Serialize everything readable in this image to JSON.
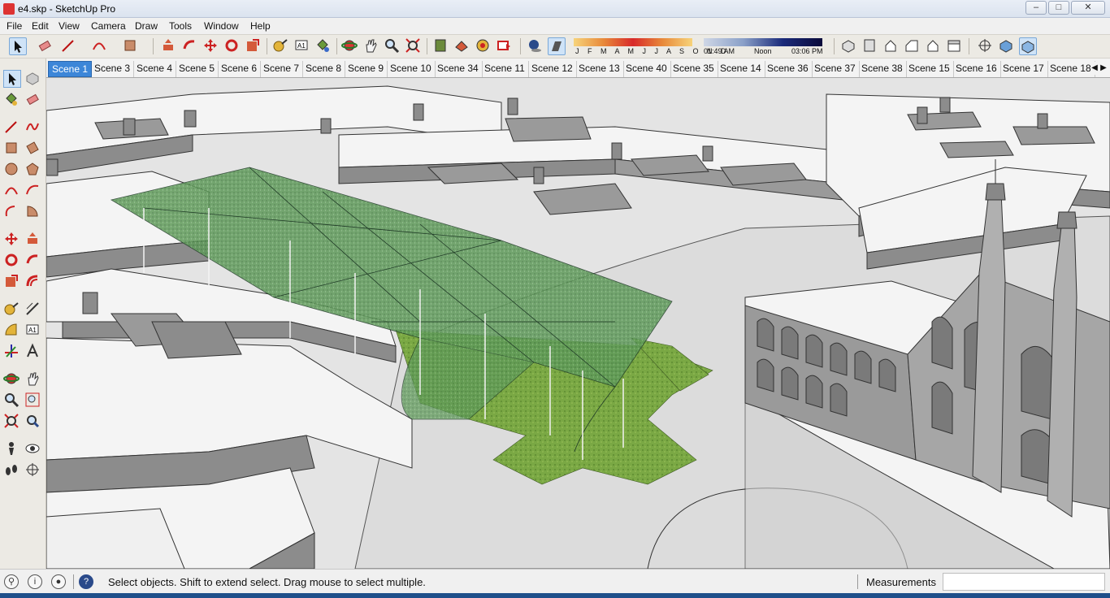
{
  "window": {
    "title": "e4.skp - SketchUp Pro",
    "controls": [
      "minimize",
      "maximize",
      "close"
    ]
  },
  "menu": [
    "File",
    "Edit",
    "View",
    "Camera",
    "Draw",
    "Tools",
    "Window",
    "Help"
  ],
  "shadow_settings": {
    "months": "J F M A M J J A S O N D",
    "time_start": "01:49 AM",
    "time_noon": "Noon",
    "time_end": "03:06 PM"
  },
  "scenes": {
    "active": "Scene 1",
    "tabs": [
      "Scene 1",
      "Scene 3",
      "Scene 4",
      "Scene 5",
      "Scene 6",
      "Scene 7",
      "Scene 8",
      "Scene 9",
      "Scene 10",
      "Scene 34",
      "Scene 11",
      "Scene 12",
      "Scene 13",
      "Scene 40",
      "Scene 35",
      "Scene 14",
      "Scene 36",
      "Scene 37",
      "Scene 38",
      "Scene 15",
      "Scene 16",
      "Scene 17",
      "Scene 18"
    ]
  },
  "status": {
    "hint": "Select objects. Shift to extend select. Drag mouse to select multiple.",
    "measurements_label": "Measurements",
    "measurements_value": ""
  },
  "colors": {
    "selection_blue": "#3c86d8",
    "canopy_green": "#5f9a5a",
    "grass_green": "#7aa844",
    "building_white": "#f4f4f4",
    "wall_grey": "#8c8c8c"
  }
}
